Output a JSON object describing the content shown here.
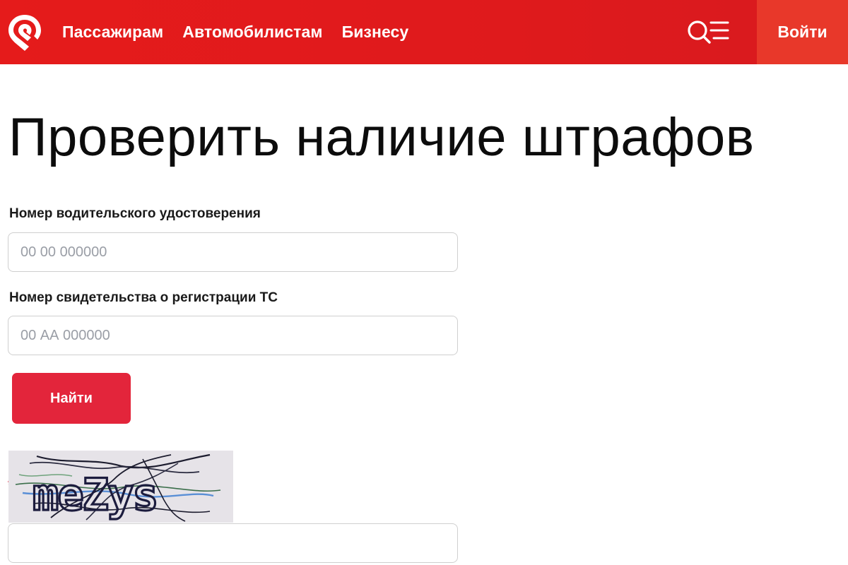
{
  "header": {
    "nav": [
      {
        "label": "Пассажирам"
      },
      {
        "label": "Автомобилистам"
      },
      {
        "label": "Бизнесу"
      }
    ],
    "login_label": "Войти",
    "logo_icon": "metro-location-pin-logo-icon",
    "search_menu_icon": "search-menu-icon",
    "colors": {
      "header_bg": "#e51b1b",
      "login_bg": "#e8382a"
    }
  },
  "main": {
    "title": "Проверить наличие штрафов",
    "license": {
      "label": "Номер водительского удостоверения",
      "placeholder": "00 00 000000",
      "value": ""
    },
    "registration": {
      "label": "Номер свидетельства о регистрации ТС",
      "placeholder": "00 АА 000000",
      "value": ""
    },
    "find_label": "Найти",
    "captcha": {
      "text": "meZys",
      "required_mark": "*",
      "input_value": ""
    },
    "colors": {
      "button_bg": "#e3253b"
    }
  }
}
